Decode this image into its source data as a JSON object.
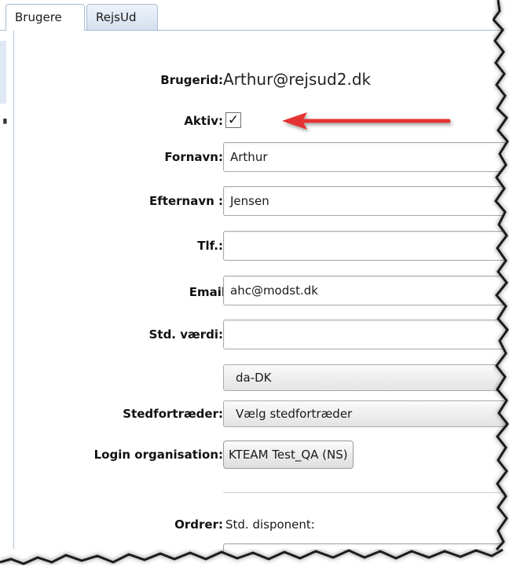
{
  "tabs": [
    "Brugere",
    "RejsUd"
  ],
  "form": {
    "userid_label": "Brugerid:",
    "userid_value": "Arthur@rejsud2.dk",
    "active_label": "Aktiv:",
    "active_checked": true,
    "active_mark": "✓",
    "firstname_label": "Fornavn:",
    "firstname_value": "Arthur",
    "lastname_label": "Efternavn :",
    "lastname_value": "Jensen",
    "phone_label": "Tlf.:",
    "phone_value": "",
    "email_label": "Email:",
    "email_value": "ahc@modst.dk",
    "stdvalue_label": "Std. værdi:",
    "stdvalue_value": "",
    "locale_value": "da-DK",
    "substitute_label": "Stedfortræder:",
    "substitute_value": "Vælg stedfortræder",
    "login_org_label": "Login organisation:",
    "login_org_value": "KTEAM Test_QA (NS)",
    "orders_label": "Ordrer:",
    "std_disponent_label": "Std. disponent:"
  },
  "annotation": {
    "arrow_color": "#e53030",
    "icon": "arrow-left-icon"
  },
  "colors": {
    "tab_border": "#a9bcd3",
    "field_border": "#a8a8a8"
  }
}
